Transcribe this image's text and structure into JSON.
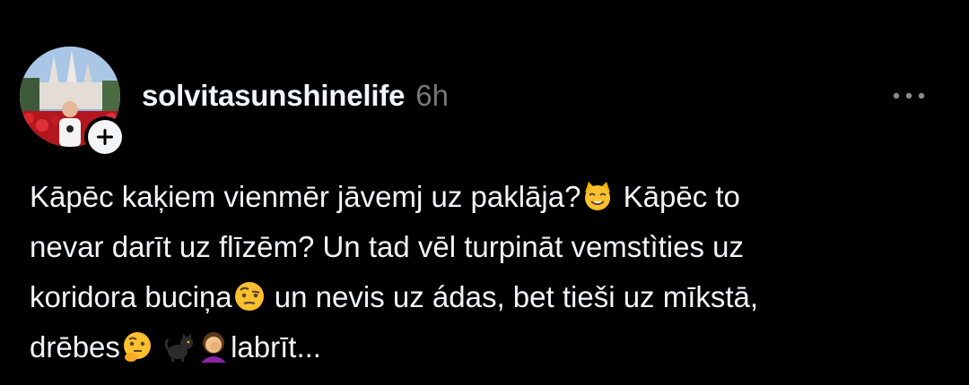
{
  "post": {
    "author": {
      "username": "solvitasunshinelife"
    },
    "timestamp": "6h",
    "text_lines": [
      {
        "a": "Kāpēc kaķiem vienmēr jāvemj uz paklāja?",
        "b": " Kāpēc to"
      },
      {
        "a": "nevar darīt uz flīzēm? Un tad vēl turpināt vemstìties uz"
      },
      {
        "a": "koridora buciņa",
        "b": " un nevis uz ádas, bet tieši uz mīkstā,"
      },
      {
        "a": "drēbes",
        "b": "labrīt..."
      }
    ],
    "emojis": [
      "cat-face-emoji",
      "raised-eyebrow-emoji",
      "thinking-face-emoji",
      "black-cat-emoji",
      "woman-facepalming-emoji"
    ]
  },
  "colors": {
    "background": "#000000",
    "text_primary": "#f3f5f7",
    "text_secondary": "#777777"
  }
}
